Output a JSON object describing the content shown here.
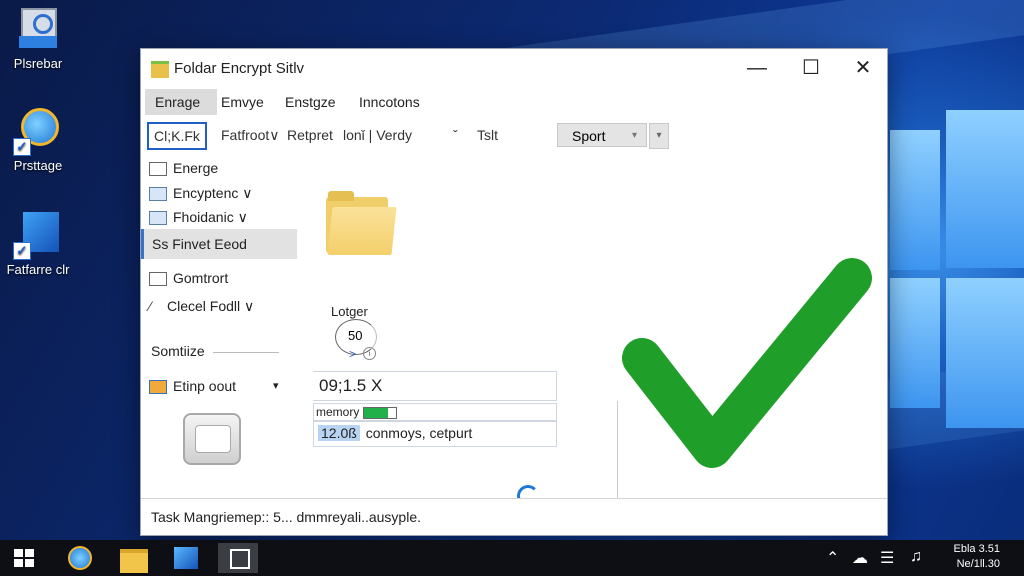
{
  "desktop": {
    "icons": [
      {
        "label": "Plsrebar"
      },
      {
        "label": "Prsttage"
      },
      {
        "label": "Fatfarre clr"
      }
    ]
  },
  "window": {
    "title": "Foldar Encrypt Sitlv",
    "controls": {
      "minimize": "—",
      "maximize": "☐",
      "close": "✕"
    }
  },
  "menu": [
    "Enrage",
    "Emvye",
    "Enstgze",
    "Inncotons"
  ],
  "toolbar": {
    "items": [
      "Cl;K.Fk",
      "Fatfroot∨",
      "Retpret",
      "lonǐ | Verdy",
      "ˇ",
      "Tslt"
    ],
    "sort_label": "Sport",
    "sort_arrow": "▾",
    "drop_arrow": "▾"
  },
  "sidebar": {
    "items": [
      {
        "label": "Energe"
      },
      {
        "label": "Encyptenc ∨"
      },
      {
        "label": "Fhoidanic ∨"
      },
      {
        "label": "Ss Finvet Eeod"
      },
      {
        "label": "Gomtrort"
      },
      {
        "label": "Clecel Fodll ∨"
      }
    ],
    "section_label": "Somtiize",
    "group_item": "Etinp oout",
    "group_arrow": "▾"
  },
  "main": {
    "logger_label": "Lotger",
    "logger_value": "50",
    "readout": "09;1.5 X",
    "memory_label": "memory",
    "memory_fill": 0.75,
    "field_code": "12.0ß",
    "field_text": "conmoys, cetpurt"
  },
  "status": {
    "text": "Task Mangriemep:: 5... dmmreyali..ausyple."
  },
  "taskbar": {
    "tray_icons": [
      "chevron-up",
      "cloud",
      "notes",
      "volume",
      "network"
    ],
    "time": "Ebla 3.51",
    "date": "Ne/1ll.30"
  },
  "colors": {
    "accent": "#1f5fc7",
    "check": "#1f9e2a",
    "memory_bar": "#22b04a"
  }
}
